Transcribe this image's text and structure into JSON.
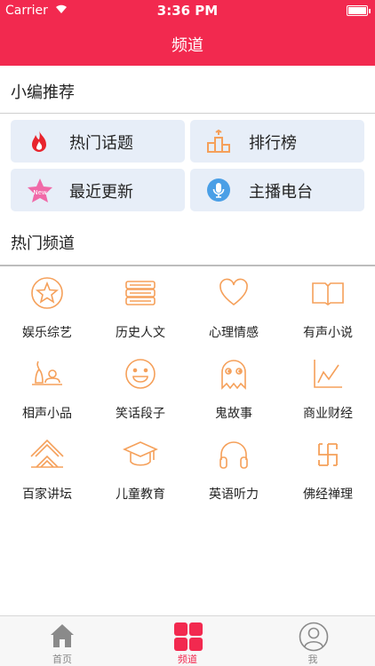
{
  "status_bar": {
    "carrier": "Carrier",
    "time": "3:36 PM"
  },
  "nav": {
    "title": "频道"
  },
  "recommend": {
    "title": "小编推荐",
    "items": [
      {
        "label": "热门话题",
        "icon": "fire-icon"
      },
      {
        "label": "排行榜",
        "icon": "podium-icon"
      },
      {
        "label": "最近更新",
        "icon": "new-star-icon"
      },
      {
        "label": "主播电台",
        "icon": "microphone-icon"
      }
    ]
  },
  "hot": {
    "title": "热门频道",
    "items": [
      {
        "label": "娱乐综艺",
        "icon": "star-circle-icon"
      },
      {
        "label": "历史人文",
        "icon": "books-icon"
      },
      {
        "label": "心理情感",
        "icon": "heart-icon"
      },
      {
        "label": "有声小说",
        "icon": "open-book-icon"
      },
      {
        "label": "相声小品",
        "icon": "performers-icon"
      },
      {
        "label": "笑话段子",
        "icon": "smiley-icon"
      },
      {
        "label": "鬼故事",
        "icon": "ghost-icon"
      },
      {
        "label": "商业财经",
        "icon": "line-chart-icon"
      },
      {
        "label": "百家讲坛",
        "icon": "pavilion-icon"
      },
      {
        "label": "儿童教育",
        "icon": "graduation-cap-icon"
      },
      {
        "label": "英语听力",
        "icon": "headphones-icon"
      },
      {
        "label": "佛经禅理",
        "icon": "swastika-icon"
      }
    ]
  },
  "tabbar": {
    "items": [
      {
        "label": "首页",
        "icon": "home-icon",
        "active": false
      },
      {
        "label": "频道",
        "icon": "grid-icon",
        "active": true
      },
      {
        "label": "我",
        "icon": "user-icon",
        "active": false
      }
    ]
  },
  "colors": {
    "brand": "#f2294f",
    "accent_orange": "#f5a05a",
    "card_bg": "#e7eef8"
  }
}
